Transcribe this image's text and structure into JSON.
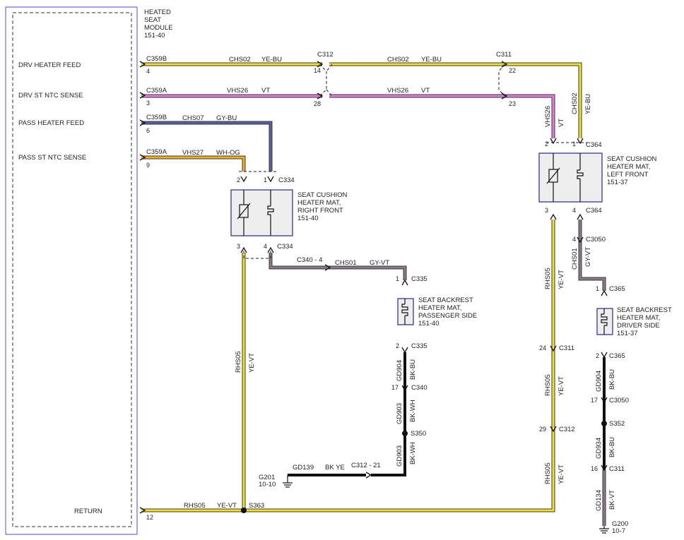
{
  "colors": {
    "yellow": "#f4e22a",
    "yellow_dark": "#3a3a2a",
    "violet": "#e47ae4",
    "gray_blue": "#5a5e9a",
    "orange": "#f0b020",
    "gray_violet": "#8a7a8a",
    "black": "#111111",
    "module_border": "#6a6adc"
  },
  "module": {
    "title_lines": [
      "HEATED",
      "SEAT",
      "MODULE",
      "151-40"
    ],
    "signals": {
      "drv_feed": "DRV HEATER FEED",
      "drv_ntc": "DRV ST NTC SENSE",
      "pass_feed": "PASS HEATER FEED",
      "pass_ntc": "PASS ST NTC SENSE",
      "return": "RETURN"
    }
  },
  "connectors": {
    "c359b_1": "C359B",
    "pin_4": "4",
    "c359a_1": "C359A",
    "pin_3": "3",
    "c359b_2": "C359B",
    "pin_6": "6",
    "c359a_2": "C359A",
    "pin_9": "9",
    "pin_12": "12",
    "c312_top": "C312",
    "pin_14": "14",
    "pin_28": "28",
    "c311_top": "C311",
    "pin_22": "22",
    "pin_23": "23",
    "c334_top": "C334",
    "c334_bot": "C334",
    "rf_pin_2": "2",
    "rf_pin_1": "1",
    "rf_pin_3": "3",
    "rf_pin_4": "4",
    "c340_4": "C340 - 4",
    "c335_top": "C335",
    "pbr_pin_1": "1",
    "c335_bot": "C335",
    "pbr_pin_2": "2",
    "c340": "C340",
    "pin_17a": "17",
    "s350": "S350",
    "c312_21": "C312 - 21",
    "g201": "G201",
    "g201_loc": "10-10",
    "s363": "S363",
    "c364_top": "C364",
    "lf_pin_2": "2",
    "lf_pin_1": "1",
    "c364_bot": "C364",
    "lf_pin_3": "3",
    "lf_pin_4": "4",
    "c3050_top": "C3050",
    "pin_4b": "4",
    "c365_top": "C365",
    "dbr_pin_1": "1",
    "c365_bot": "C365",
    "dbr_pin_2": "2",
    "c3050_bot": "C3050",
    "pin_17b": "17",
    "s352": "S352",
    "c311_mid": "C311",
    "pin_24": "24",
    "c312_mid": "C312",
    "pin_29": "29",
    "c311_low": "C311",
    "pin_16": "16",
    "g200": "G200",
    "g200_loc": "10-7"
  },
  "wires": {
    "chs02_a": "CHS02",
    "yebu_a": "YE-BU",
    "chs02_b": "CHS02",
    "yebu_b": "YE-BU",
    "vhs26_a": "VHS26",
    "vt_a": "VT",
    "vhs26_b": "VHS26",
    "vt_b": "VT",
    "chs07": "CHS07",
    "gybu": "GY-BU",
    "vhs27": "VHS27",
    "whog": "WH-OG",
    "vhs26_v": "VHS26",
    "vt_v": "VT",
    "chs02_v": "CHS02",
    "yebu_v": "YE-BU",
    "chs01_h": "CHS01",
    "gyvt_h": "GY-VT",
    "rhs05_left": "RHS05",
    "yevt_left": "YE-VT",
    "gd904_p": "GD904",
    "bkbu_p": "BK-BU",
    "gd903_p1": "GD903",
    "bkwh_p1": "BK-WH",
    "gd903_p2": "GD903",
    "bkwh_p2": "BK-WH",
    "gd139": "GD139",
    "bkye": "BK YE",
    "rhs05_bot": "RHS05",
    "yevt_bot": "YE-VT",
    "rhs05_r1": "RHS05",
    "yevt_r1": "YE-VT",
    "rhs05_r2": "RHS05",
    "yevt_r2": "YE-VT",
    "rhs05_r3": "RHS05",
    "yevt_r3": "YE-VT",
    "chs01_v": "CHS01",
    "gyvt_v": "GY-VT",
    "gd904_d": "GD904",
    "bkbu_d": "BK-BU",
    "gd934": "GD934",
    "bkbu_d2": "BK-BU",
    "gd134": "GD134",
    "bkvt": "BK-VT"
  },
  "components": {
    "rf": {
      "lines": [
        "SEAT CUSHION",
        "HEATER MAT,",
        "RIGHT FRONT",
        "151-40"
      ]
    },
    "lf": {
      "lines": [
        "SEAT CUSHION",
        "HEATER MAT,",
        "LEFT FRONT",
        "151-37"
      ]
    },
    "pbr": {
      "lines": [
        "SEAT BACKREST",
        "HEATER MAT,",
        "PASSENGER SIDE",
        "151-40"
      ]
    },
    "dbr": {
      "lines": [
        "SEAT BACKREST",
        "HEATER MAT,",
        "DRIVER SIDE",
        "151-37"
      ]
    }
  }
}
